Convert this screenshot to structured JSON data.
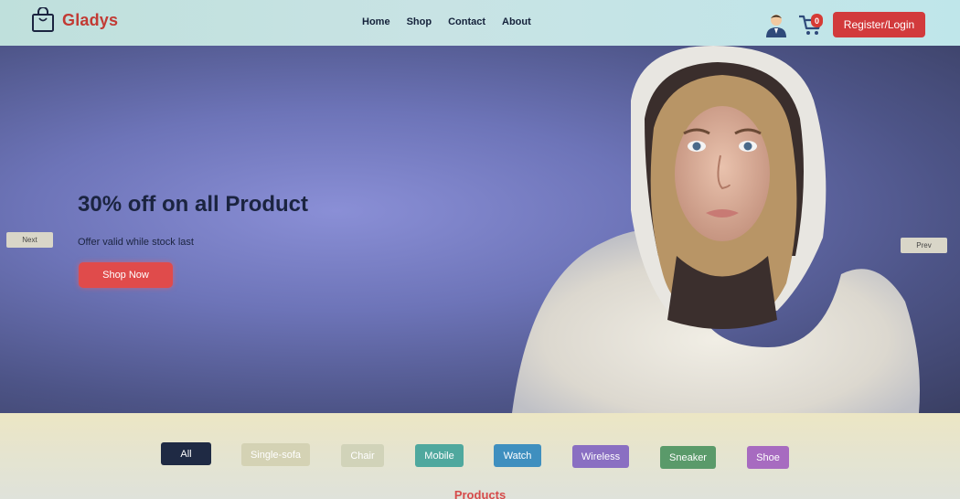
{
  "brand": {
    "name": "Gladys",
    "icon": "shopping-bag-icon",
    "color": "#c23a34"
  },
  "nav": {
    "items": [
      "Home",
      "Shop",
      "Contact",
      "About"
    ]
  },
  "header": {
    "avatar_icon": "user-avatar-icon",
    "cart_icon": "cart-icon",
    "cart_count": "0",
    "login_label": "Register/Login"
  },
  "hero": {
    "title": "30% off on all Product",
    "subtitle": "Offer valid while stock last",
    "cta_label": "Shop Now",
    "next_label": "Next",
    "prev_label": "Prev"
  },
  "filters": {
    "items": [
      {
        "label": "All",
        "color": "#1f2a44"
      },
      {
        "label": "Single-sofa",
        "color": "#d4d2b4"
      },
      {
        "label": "Chair",
        "color": "#d1d3b9"
      },
      {
        "label": "Mobile",
        "color": "#4fa89e"
      },
      {
        "label": "Watch",
        "color": "#3f8fbf"
      },
      {
        "label": "Wireless",
        "color": "#8a6fc2"
      },
      {
        "label": "Sneaker",
        "color": "#5a9a6a"
      },
      {
        "label": "Shoe",
        "color": "#a76bc0"
      }
    ]
  },
  "products": {
    "title": "Products"
  },
  "colors": {
    "accent": "#d23a3c",
    "header_bg": "#c8e3e4"
  }
}
